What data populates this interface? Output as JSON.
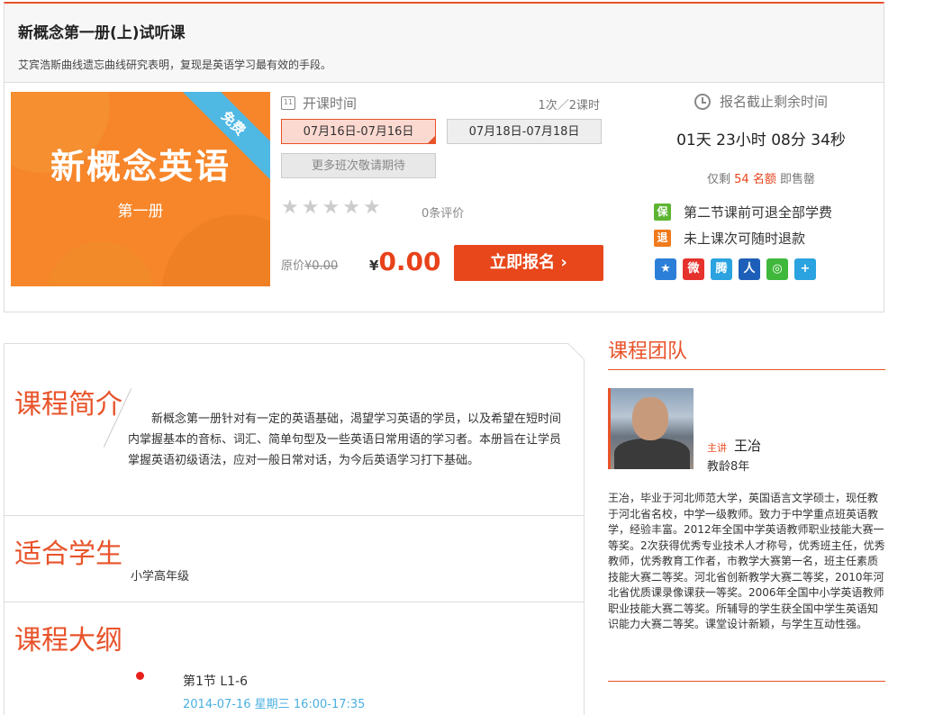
{
  "course": {
    "title": "新概念第一册(上)试听课",
    "subtitle": "艾宾浩斯曲线遗忘曲线研究表明，复现是英语学习最有效的手段。",
    "cover_main": "新概念英语",
    "cover_sub": "第一册",
    "ribbon": "免费"
  },
  "schedule": {
    "label": "开课时间",
    "count": "1次／2课时",
    "dates": [
      "07月16日-07月16日",
      "07月18日-07月18日"
    ],
    "more": "更多班次敬请期待"
  },
  "rating": {
    "stars": 0,
    "max": 5,
    "reviews": "0条评价"
  },
  "pricing": {
    "orig_label": "原价",
    "orig_price": "¥0.00",
    "currency": "¥",
    "price": "0.00",
    "enroll": "立即报名 ›"
  },
  "deadline": {
    "label": "报名截止剩余时间",
    "days": "01",
    "days_unit": "天",
    "hours": "23",
    "hours_unit": "小时",
    "mins": "08",
    "mins_unit": "分",
    "secs": "34",
    "secs_unit": "秒"
  },
  "seats": {
    "pre": "仅剩",
    "n": "54 名额",
    "post": "即售罄"
  },
  "guarantees": [
    {
      "badge": "保",
      "text": "第二节课前可退全部学费",
      "color": "#5cb531"
    },
    {
      "badge": "退",
      "text": "未上课次可随时退款",
      "color": "#f07a1c"
    }
  ],
  "share_icons": [
    {
      "name": "qzone-icon",
      "glyph": "★",
      "color": "#2b7fd8"
    },
    {
      "name": "weibo-icon",
      "glyph": "微",
      "color": "#e6322d"
    },
    {
      "name": "tencent-weibo-icon",
      "glyph": "腾",
      "color": "#2aa3e0"
    },
    {
      "name": "renren-icon",
      "glyph": "人",
      "color": "#1d5fb8"
    },
    {
      "name": "wechat-icon",
      "glyph": "◎",
      "color": "#3fb83b"
    },
    {
      "name": "more-share-icon",
      "glyph": "+",
      "color": "#2aa3e0"
    }
  ],
  "intro": {
    "title": "课程简介",
    "text": "新概念第一册针对有一定的英语基础，渴望学习英语的学员，以及希望在短时间内掌握基本的音标、词汇、简单句型及一些英语日常用语的学习者。本册旨在让学员掌握英语初级语法，应对一般日常对话，为今后英语学习打下基础。"
  },
  "suitable": {
    "title": "适合学生",
    "text": "小学高年级"
  },
  "outline": {
    "title": "课程大纲",
    "lesson": "第1节  L1-6",
    "time": "2014-07-16 星期三 16:00-17:35"
  },
  "team": {
    "title": "课程团队",
    "role": "主讲",
    "name": "王冶",
    "experience": "教龄8年",
    "bio": "王冶，毕业于河北师范大学，英国语言文学硕士，现任教于河北省名校，中学一级教师。致力于中学重点班英语教学，经验丰富。2012年全国中学英语教师职业技能大赛一等奖。2次获得优秀专业技术人才称号，优秀班主任，优秀教师，优秀教育工作者，市教学大赛第一名，班主任素质技能大赛二等奖。河北省创新教学大赛二等奖，2010年河北省优质课录像课获一等奖。2006年全国中小学英语教师职业技能大赛二等奖。所辅导的学生获全国中学生英语知识能力大赛二等奖。课堂设计新颖，与学生互动性强。"
  },
  "colors": {
    "accent": "#e8532a",
    "price": "#e8421a",
    "link": "#4ab0e0"
  }
}
